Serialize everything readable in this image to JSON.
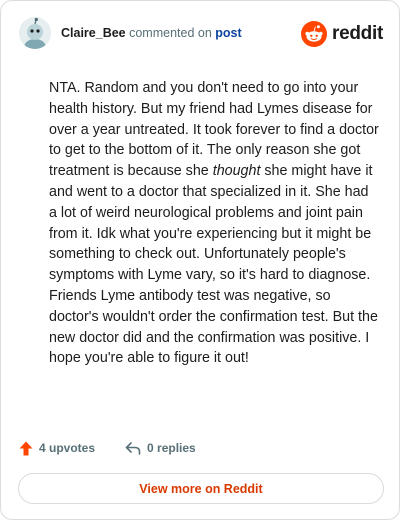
{
  "comment": {
    "username": "Claire_Bee",
    "action_text": "commented on",
    "post_link": "post",
    "body_before": "NTA. Random and you don't need to go into your health history. But my friend had Lymes disease for over a year untreated. It took forever to find a doctor to get to the bottom of it. The only reason she got treatment is because she ",
    "body_emphasis": "thought",
    "body_after": " she might have it and went to a doctor that specialized in it. She had a lot of weird neurological problems and joint pain from it. Idk what you're experiencing but it might be something to check out. Unfortunately people's symptoms with Lyme vary, so it's hard to diagnose. Friends Lyme antibody test was negative, so doctor's wouldn't order the confirmation test. But the new doctor did and the confirmation was positive. I hope you're able to figure it out!"
  },
  "brand": {
    "name": "reddit",
    "icon": "reddit-snoo-icon",
    "color": "#ff4500"
  },
  "actions": {
    "upvotes": "4 upvotes",
    "replies": "0 replies",
    "upvote_icon": "upvote-arrow-icon",
    "reply_icon": "reply-arrow-icon",
    "upvote_color": "#ff4500"
  },
  "footer": {
    "view_more": "View more on Reddit",
    "accent": "#d93a00"
  }
}
